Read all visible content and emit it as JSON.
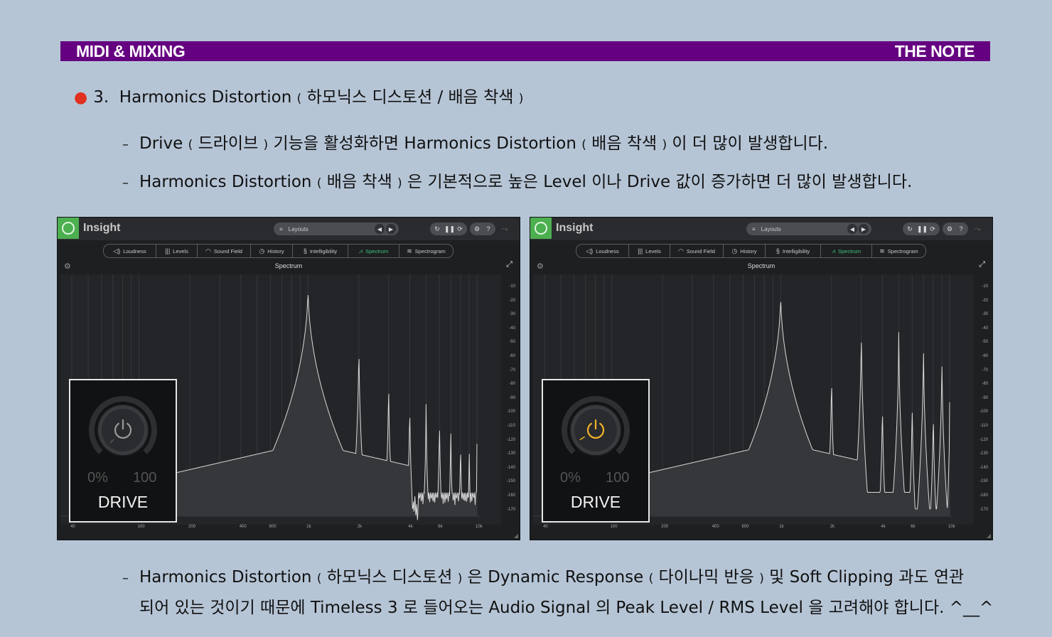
{
  "header": {
    "left": "MIDI & MIXING",
    "right": "THE NOTE"
  },
  "bullet": {
    "num": "3.",
    "en": "Harmonics Distortion",
    "ko": "하모닉스 디스토션 / 배음 착색"
  },
  "line1": {
    "a": "Drive",
    "b": "드라이브",
    "c": "기능을 활성화하면 Harmonics Distortion",
    "d": "배음 착색",
    "e": "이 더 많이 발생합니다."
  },
  "line2": {
    "a": "Harmonics Distortion",
    "b": "배음 착색",
    "c": "은 기본적으로 높은 Level 이나 Drive 값이 증가하면 더 많이 발생합니다."
  },
  "line3": {
    "a": "Harmonics Distortion",
    "b": "하모닉스 디스토션",
    "c": "은 Dynamic Response",
    "d": "다이나믹 반응",
    "e": "및 Soft Clipping 과도 연관"
  },
  "line4": {
    "a": "되어 있는 것이기 때문에 Timeless 3 로 들어오는 Audio Signal 의 Peak Level / RMS Level 을 고려해야 합니다. ^__^"
  },
  "plugin": {
    "title": "Insight",
    "layouts": "Layouts",
    "panel_title": "Spectrum",
    "tabs": [
      "Loudness",
      "Levels",
      "Sound Field",
      "History",
      "Intelligibility",
      "Spectrum",
      "Spectrogram"
    ],
    "active_tab": "Spectrum",
    "db_ticks": [
      "-10",
      "-20",
      "-30",
      "-40",
      "-50",
      "-60",
      "-70",
      "-80",
      "-90",
      "-100",
      "-110",
      "-120",
      "-130",
      "-140",
      "-150",
      "-160",
      "-170"
    ],
    "freq_ticks": [
      "40",
      "100",
      "200",
      "400",
      "600",
      "1k",
      "2k",
      "4k",
      "6k",
      "10k"
    ]
  },
  "drive": {
    "min": "0%",
    "max": "100",
    "label": "DRIVE"
  },
  "states": [
    {
      "drive_on": false,
      "drive_level": 0.0
    },
    {
      "drive_on": true,
      "drive_level": 0.05
    }
  ],
  "colors": {
    "header_bg": "#650080",
    "page_bg": "#b6c5d6",
    "bullet": "#e0301e",
    "accent": "#3fc27a",
    "drive_on": "#f0b429",
    "drive_off": "#9a9a9a"
  },
  "icons": [
    "power-icon",
    "gear-icon",
    "help-icon",
    "expand-icon",
    "menu-icon"
  ]
}
